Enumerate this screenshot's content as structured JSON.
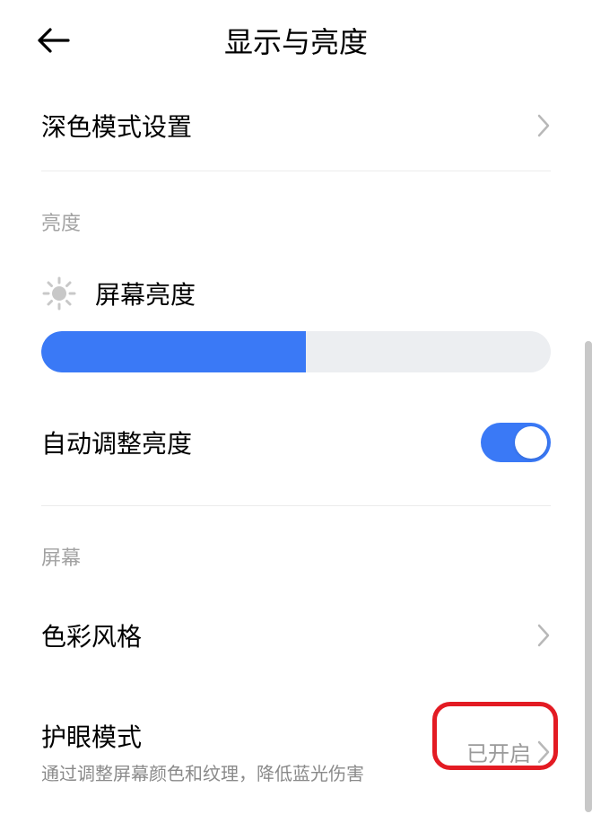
{
  "header": {
    "title": "显示与亮度"
  },
  "rows": {
    "darkMode": {
      "label": "深色模式设置"
    },
    "brightnessGroup": {
      "title": "亮度"
    },
    "screenBrightness": {
      "label": "屏幕亮度",
      "percent": 52
    },
    "autoBrightness": {
      "label": "自动调整亮度"
    },
    "screenGroup": {
      "title": "屏幕"
    },
    "colorStyle": {
      "label": "色彩风格"
    },
    "eyeCare": {
      "label": "护眼模式",
      "desc": "通过调整屏幕颜色和纹理，降低蓝光伤害",
      "value": "已开启"
    }
  }
}
